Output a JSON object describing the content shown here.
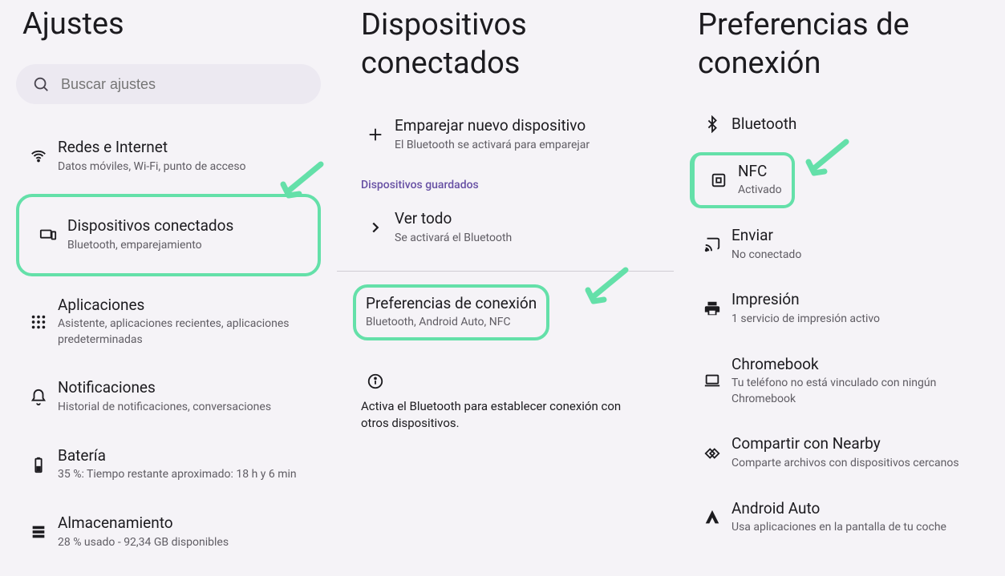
{
  "panel1": {
    "title": "Ajustes",
    "search_placeholder": "Buscar ajustes",
    "items": [
      {
        "title": "Redes e Internet",
        "sub": "Datos móviles, Wi-Fi, punto de acceso"
      },
      {
        "title": "Dispositivos conectados",
        "sub": "Bluetooth, emparejamiento"
      },
      {
        "title": "Aplicaciones",
        "sub": "Asistente, aplicaciones recientes, aplicaciones predeterminadas"
      },
      {
        "title": "Notificaciones",
        "sub": "Historial de notificaciones, conversaciones"
      },
      {
        "title": "Batería",
        "sub": "35 %: Tiempo restante aproximado: 18 h y 6 min"
      },
      {
        "title": "Almacenamiento",
        "sub": "28 % usado - 92,34 GB disponibles"
      }
    ]
  },
  "panel2": {
    "title": "Dispositivos conectados",
    "pair": {
      "title": "Emparejar nuevo dispositivo",
      "sub": "El Bluetooth se activará para emparejar"
    },
    "saved_label": "Dispositivos guardados",
    "see_all": {
      "title": "Ver todo",
      "sub": "Se activará el Bluetooth"
    },
    "prefs": {
      "title": "Preferencias de conexión",
      "sub": "Bluetooth, Android Auto, NFC"
    },
    "info": "Activa el Bluetooth para establecer conexión con otros dispositivos."
  },
  "panel3": {
    "title": "Preferencias de conexión",
    "items": [
      {
        "title": "Bluetooth",
        "sub": ""
      },
      {
        "title": "NFC",
        "sub": "Activado"
      },
      {
        "title": "Enviar",
        "sub": "No conectado"
      },
      {
        "title": "Impresión",
        "sub": "1 servicio de impresión activo"
      },
      {
        "title": "Chromebook",
        "sub": "Tu teléfono no está vinculado con ningún Chromebook"
      },
      {
        "title": "Compartir con Nearby",
        "sub": "Comparte archivos con dispositivos cercanos"
      },
      {
        "title": "Android Auto",
        "sub": "Usa aplicaciones en la pantalla de tu coche"
      }
    ]
  }
}
